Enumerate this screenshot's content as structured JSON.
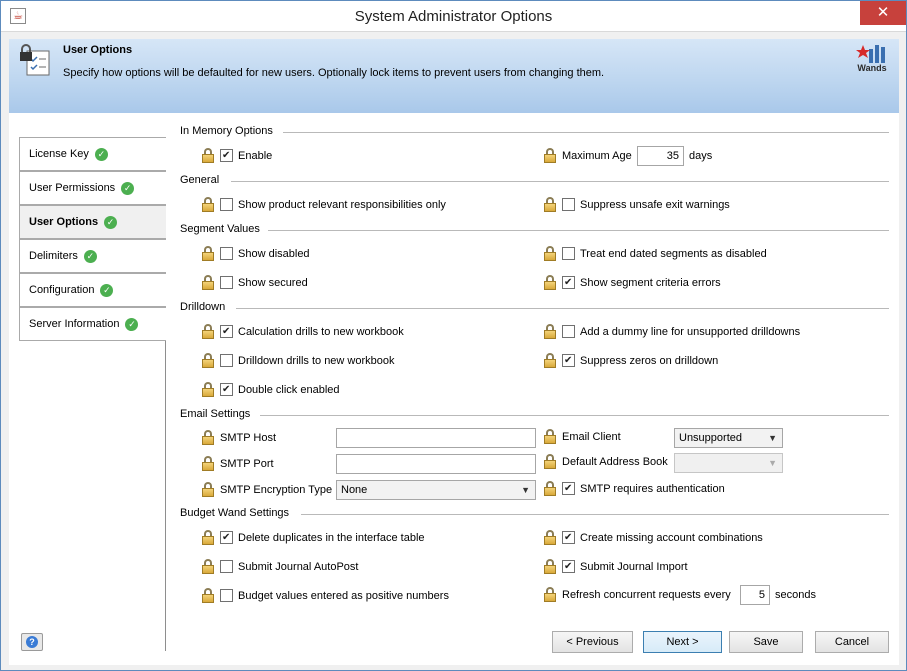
{
  "window": {
    "title": "System Administrator Options",
    "close_glyph": "✕"
  },
  "banner": {
    "title": "User Options",
    "description": "Specify how options will be defaulted for new users. Optionally lock items to prevent users from changing them.",
    "brand": "Wands"
  },
  "nav": {
    "items": [
      {
        "label": "License Key"
      },
      {
        "label": "User Permissions"
      },
      {
        "label": "User Options"
      },
      {
        "label": "Delimiters"
      },
      {
        "label": "Configuration"
      },
      {
        "label": "Server Information"
      }
    ],
    "active": "User Options"
  },
  "sections": {
    "memory": {
      "title": "In Memory Options",
      "enable": {
        "label": "Enable",
        "checked": true
      },
      "max_age": {
        "label": "Maximum Age",
        "value": "35",
        "unit": "days"
      }
    },
    "general": {
      "title": "General",
      "show_product": {
        "label": "Show product relevant responsibilities only",
        "checked": false
      },
      "suppress_exit": {
        "label": "Suppress unsafe exit warnings",
        "checked": false
      }
    },
    "segment": {
      "title": "Segment Values",
      "show_disabled": {
        "label": "Show disabled",
        "checked": false
      },
      "treat_end_dated": {
        "label": "Treat end dated segments as disabled",
        "checked": false
      },
      "show_secured": {
        "label": "Show secured",
        "checked": false
      },
      "show_criteria_errors": {
        "label": "Show segment criteria errors",
        "checked": true
      }
    },
    "drilldown": {
      "title": "Drilldown",
      "calc_drills": {
        "label": "Calculation drills to new workbook",
        "checked": true
      },
      "dummy_line": {
        "label": "Add a dummy line for unsupported drilldowns",
        "checked": false
      },
      "drilldown_drills": {
        "label": "Drilldown drills to new workbook",
        "checked": false
      },
      "suppress_zeros": {
        "label": "Suppress zeros on drilldown",
        "checked": true
      },
      "double_click": {
        "label": "Double click enabled",
        "checked": true
      }
    },
    "email": {
      "title": "Email Settings",
      "smtp_host": {
        "label": "SMTP Host",
        "value": ""
      },
      "smtp_port": {
        "label": "SMTP Port",
        "value": ""
      },
      "smtp_encryption": {
        "label": "SMTP Encryption Type",
        "value": "None"
      },
      "email_client": {
        "label": "Email Client",
        "value": "Unsupported"
      },
      "default_address_book": {
        "label": "Default Address Book",
        "value": ""
      },
      "smtp_auth": {
        "label": "SMTP requires authentication",
        "checked": true
      }
    },
    "budget": {
      "title": "Budget Wand Settings",
      "delete_duplicates": {
        "label": "Delete duplicates in the interface table",
        "checked": true
      },
      "create_missing": {
        "label": "Create missing account combinations",
        "checked": true
      },
      "submit_autopost": {
        "label": "Submit Journal AutoPost",
        "checked": false
      },
      "submit_import": {
        "label": "Submit Journal Import",
        "checked": true
      },
      "positive_numbers": {
        "label": "Budget values entered as positive numbers",
        "checked": false
      },
      "refresh": {
        "label": "Refresh concurrent requests every",
        "value": "5",
        "unit": "seconds"
      }
    }
  },
  "buttons": {
    "previous": "< Previous",
    "next": "Next >",
    "save": "Save",
    "cancel": "Cancel"
  }
}
